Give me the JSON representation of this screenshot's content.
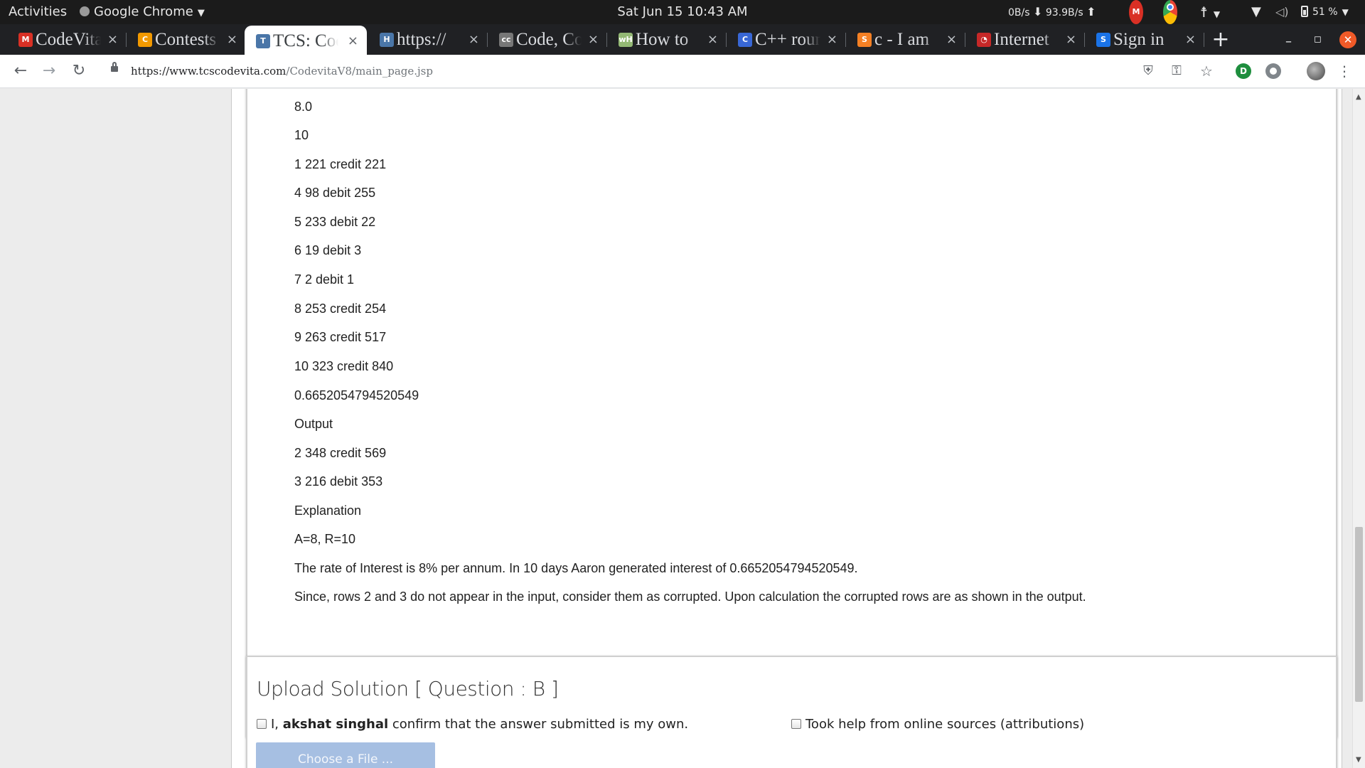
{
  "topbar": {
    "activities": "Activities",
    "app_name": "Google Chrome",
    "clock": "Sat Jun 15  10:43 AM",
    "net_up": "0B/s",
    "net_down": "93.9B/s",
    "gmail_badge": "M",
    "battery": "51 %"
  },
  "tabs": [
    {
      "title": "CodeVita",
      "favicon": "gmail-icon",
      "color": "#d93025",
      "glyph": "M"
    },
    {
      "title": "Contests",
      "favicon": "contest-icon",
      "color": "#f29900",
      "glyph": "C"
    },
    {
      "title": "TCS: CodeVita",
      "favicon": "tcs-icon",
      "color": "#4a76a8",
      "glyph": "T",
      "active": true
    },
    {
      "title": "https://",
      "favicon": "page-icon",
      "color": "#4a76a8",
      "glyph": "H"
    },
    {
      "title": "Code, Compile",
      "favicon": "cc-icon",
      "color": "#777777",
      "glyph": "cc"
    },
    {
      "title": "How to",
      "favicon": "wikihow-icon",
      "color": "#93b874",
      "glyph": "wH"
    },
    {
      "title": "C++ round",
      "favicon": "cpp-icon",
      "color": "#3867d6",
      "glyph": "C"
    },
    {
      "title": "c - I am",
      "favicon": "stackoverflow-icon",
      "color": "#f48024",
      "glyph": "S"
    },
    {
      "title": "Internet",
      "favicon": "speed-icon",
      "color": "#c62828",
      "glyph": "◔"
    },
    {
      "title": "Sign in",
      "favicon": "s-icon",
      "color": "#1a73e8",
      "glyph": "S"
    }
  ],
  "new_tab": "+",
  "url": {
    "host": "https://www.tcscodevita.com",
    "path": "/CodevitaV8/main_page.jsp"
  },
  "problem": {
    "lines": [
      "8.0",
      "10",
      "1 221 credit 221",
      "4 98 debit 255",
      "5 233 debit 22",
      "6 19 debit 3",
      "7 2 debit 1",
      "8 253 credit 254",
      "9 263 credit 517",
      "10 323 credit 840",
      "0.6652054794520549",
      "Output",
      "2 348 credit 569",
      "3 216 debit 353",
      "Explanation",
      "A=8, R=10",
      "The rate of Interest is 8% per annum. In 10 days Aaron generated interest of 0.6652054794520549.",
      "Since, rows 2 and 3 do not appear in the input, consider them as corrupted. Upon calculation the corrupted rows are as shown in the output."
    ]
  },
  "upload": {
    "title": "Upload Solution [ Question : B ]",
    "own_prefix": "I, ",
    "user_name": "akshat singhal",
    "own_suffix": " confirm that the answer submitted is my own.",
    "help_label": "Took help from online sources (attributions)",
    "choose_file": "Choose a File ..."
  }
}
